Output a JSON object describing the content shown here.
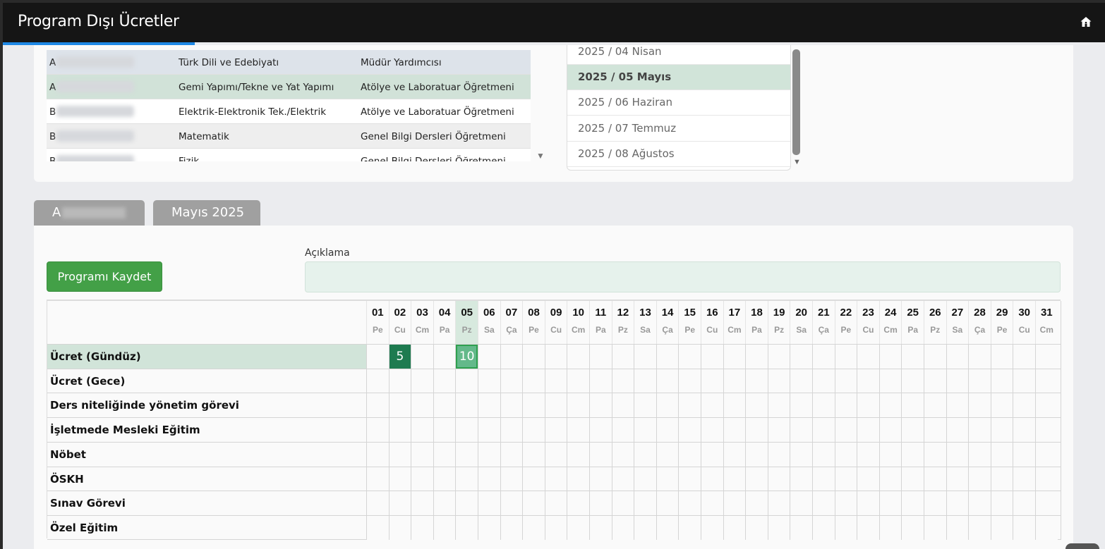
{
  "header": {
    "title": "Program Dışı Ücretler",
    "home_icon": "home-icon"
  },
  "teachers": {
    "rows": [
      {
        "initial": "A",
        "branch": "Türk Dili ve Edebiyatı",
        "role": "Müdür Yardımcısı"
      },
      {
        "initial": "A",
        "branch": "Gemi Yapımı/Tekne ve Yat Yapımı",
        "role": "Atölye ve Laboratuar Öğretmeni"
      },
      {
        "initial": "B",
        "branch": "Elektrik-Elektronik Tek./Elektrik",
        "role": "Atölye ve Laboratuar Öğretmeni"
      },
      {
        "initial": "B",
        "branch": "Matematik",
        "role": "Genel Bilgi Dersleri Öğretmeni"
      },
      {
        "initial": "B",
        "branch": "Fizik",
        "role": "Genel Bilgi Dersleri Öğretmeni"
      }
    ]
  },
  "months": {
    "items": [
      "2025 / 04 Nisan",
      "2025 / 05 Mayıs",
      "2025 / 06 Haziran",
      "2025 / 07 Temmuz",
      "2025 / 08 Ağustos"
    ],
    "selected": "2025 / 05 Mayıs"
  },
  "tabs": {
    "teacher_initial": "A",
    "month": "Mayıs 2025"
  },
  "form": {
    "save_label": "Programı Kaydet",
    "aciklama_label": "Açıklama",
    "aciklama_value": ""
  },
  "calendar": {
    "days": [
      "01",
      "02",
      "03",
      "04",
      "05",
      "06",
      "07",
      "08",
      "09",
      "10",
      "11",
      "12",
      "13",
      "14",
      "15",
      "16",
      "17",
      "18",
      "19",
      "20",
      "21",
      "22",
      "23",
      "24",
      "25",
      "26",
      "27",
      "28",
      "29",
      "30",
      "31"
    ],
    "weekdays": [
      "Pe",
      "Cu",
      "Cm",
      "Pa",
      "Pz",
      "Sa",
      "Ça",
      "Pe",
      "Cu",
      "Cm",
      "Pa",
      "Pz",
      "Sa",
      "Ça",
      "Pe",
      "Cu",
      "Cm",
      "Pa",
      "Pz",
      "Sa",
      "Ça",
      "Pe",
      "Cu",
      "Cm",
      "Pa",
      "Pz",
      "Sa",
      "Ça",
      "Pe",
      "Cu",
      "Cm"
    ],
    "highlighted_day": "05",
    "rows": [
      {
        "label": "Ücret (Gündüz)",
        "values": {
          "02": "5",
          "05": "10"
        }
      },
      {
        "label": "Ücret (Gece)",
        "values": {}
      },
      {
        "label": "Ders niteliğinde yönetim görevi",
        "values": {}
      },
      {
        "label": "İşletmede Mesleki Eğitim",
        "values": {}
      },
      {
        "label": "Nöbet",
        "values": {}
      },
      {
        "label": "ÖSKH",
        "values": {}
      },
      {
        "label": "Sınav Görevi",
        "values": {}
      },
      {
        "label": "Özel Eğitim",
        "values": {}
      }
    ]
  }
}
